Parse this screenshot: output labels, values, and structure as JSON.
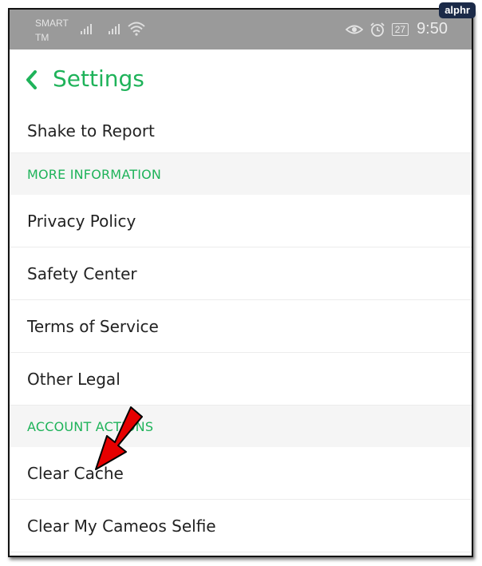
{
  "status_bar": {
    "carrier_line1": "SMART",
    "carrier_line2": "TM",
    "time": "9:50",
    "battery": "27"
  },
  "header": {
    "title": "Settings"
  },
  "items": {
    "shake_to_report": "Shake to Report",
    "section_more_information": "MORE INFORMATION",
    "privacy_policy": "Privacy Policy",
    "safety_center": "Safety Center",
    "terms_of_service": "Terms of Service",
    "other_legal": "Other Legal",
    "section_account_actions": "ACCOUNT ACTIONS",
    "clear_cache": "Clear Cache",
    "clear_cameos_selfie": "Clear My Cameos Selfie"
  },
  "watermark": "alphr",
  "colors": {
    "accent": "#1fb35a",
    "arrow": "#e60000",
    "status_bar": "#9a9a9a"
  },
  "icons": [
    "signal-icon",
    "wifi-icon",
    "eye-icon",
    "alarm-icon",
    "battery-icon",
    "back-chevron-icon",
    "red-arrow-icon"
  ]
}
